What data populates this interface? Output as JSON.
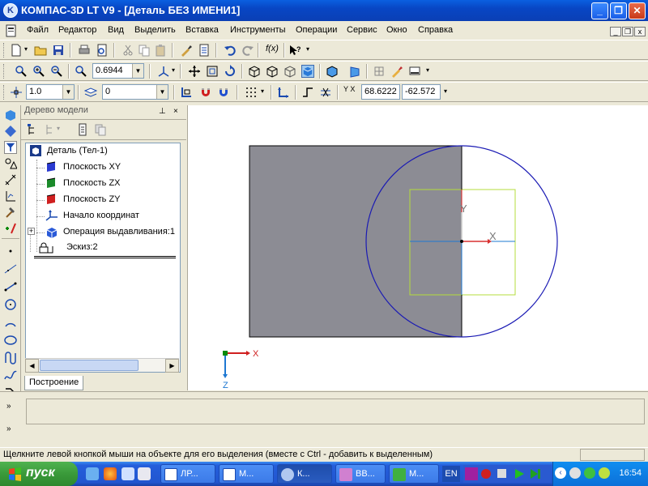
{
  "window": {
    "title": "КОМПАС-3D LT V9 - [Деталь БЕЗ ИМЕНИ1]",
    "app_icon": "compas-icon",
    "buttons": [
      "_",
      "❐",
      "✕"
    ]
  },
  "menu": {
    "items": [
      "Файл",
      "Редактор",
      "Вид",
      "Выделить",
      "Вставка",
      "Инструменты",
      "Операции",
      "Сервис",
      "Окно",
      "Справка"
    ]
  },
  "toolbar2": {
    "zoom_value": "0.6944"
  },
  "toolbar3": {
    "step_value": "1.0",
    "layer_value": "0",
    "coord_x": "68.6222",
    "coord_y": "-62.572",
    "xy_label": "Y X"
  },
  "tree": {
    "header": "Дерево модели",
    "pin": "ᵩ x",
    "root": "Деталь (Тел-1)",
    "nodes": [
      "Плоскость XY",
      "Плоскость ZX",
      "Плоскость ZY",
      "Начало координат",
      "Операция выдавливания:1",
      "Эскиз:2"
    ],
    "tab": "Построение"
  },
  "canvas": {
    "axis_x_label": "X",
    "axis_y_label": "Y",
    "triad_x": "X",
    "triad_z": "Z"
  },
  "statusbar": {
    "text": "Щелкните левой кнопкой мыши на объекте для его выделения (вместе с Ctrl - добавить к выделенным)"
  },
  "taskbar": {
    "start_label": "пуск",
    "tasks": [
      "ЛР...",
      "М...",
      "К...",
      "ВВ...",
      "М..."
    ],
    "language": "EN",
    "clock": "16:54"
  },
  "colors": {
    "titlebar": "#0a46c4",
    "part_fill": "#8c8c94",
    "circle_stroke": "#1a1ab4",
    "sketch_rect": "#b4dc3c",
    "axis_blue": "#1e78d2",
    "axis_red": "#e01e1e"
  }
}
